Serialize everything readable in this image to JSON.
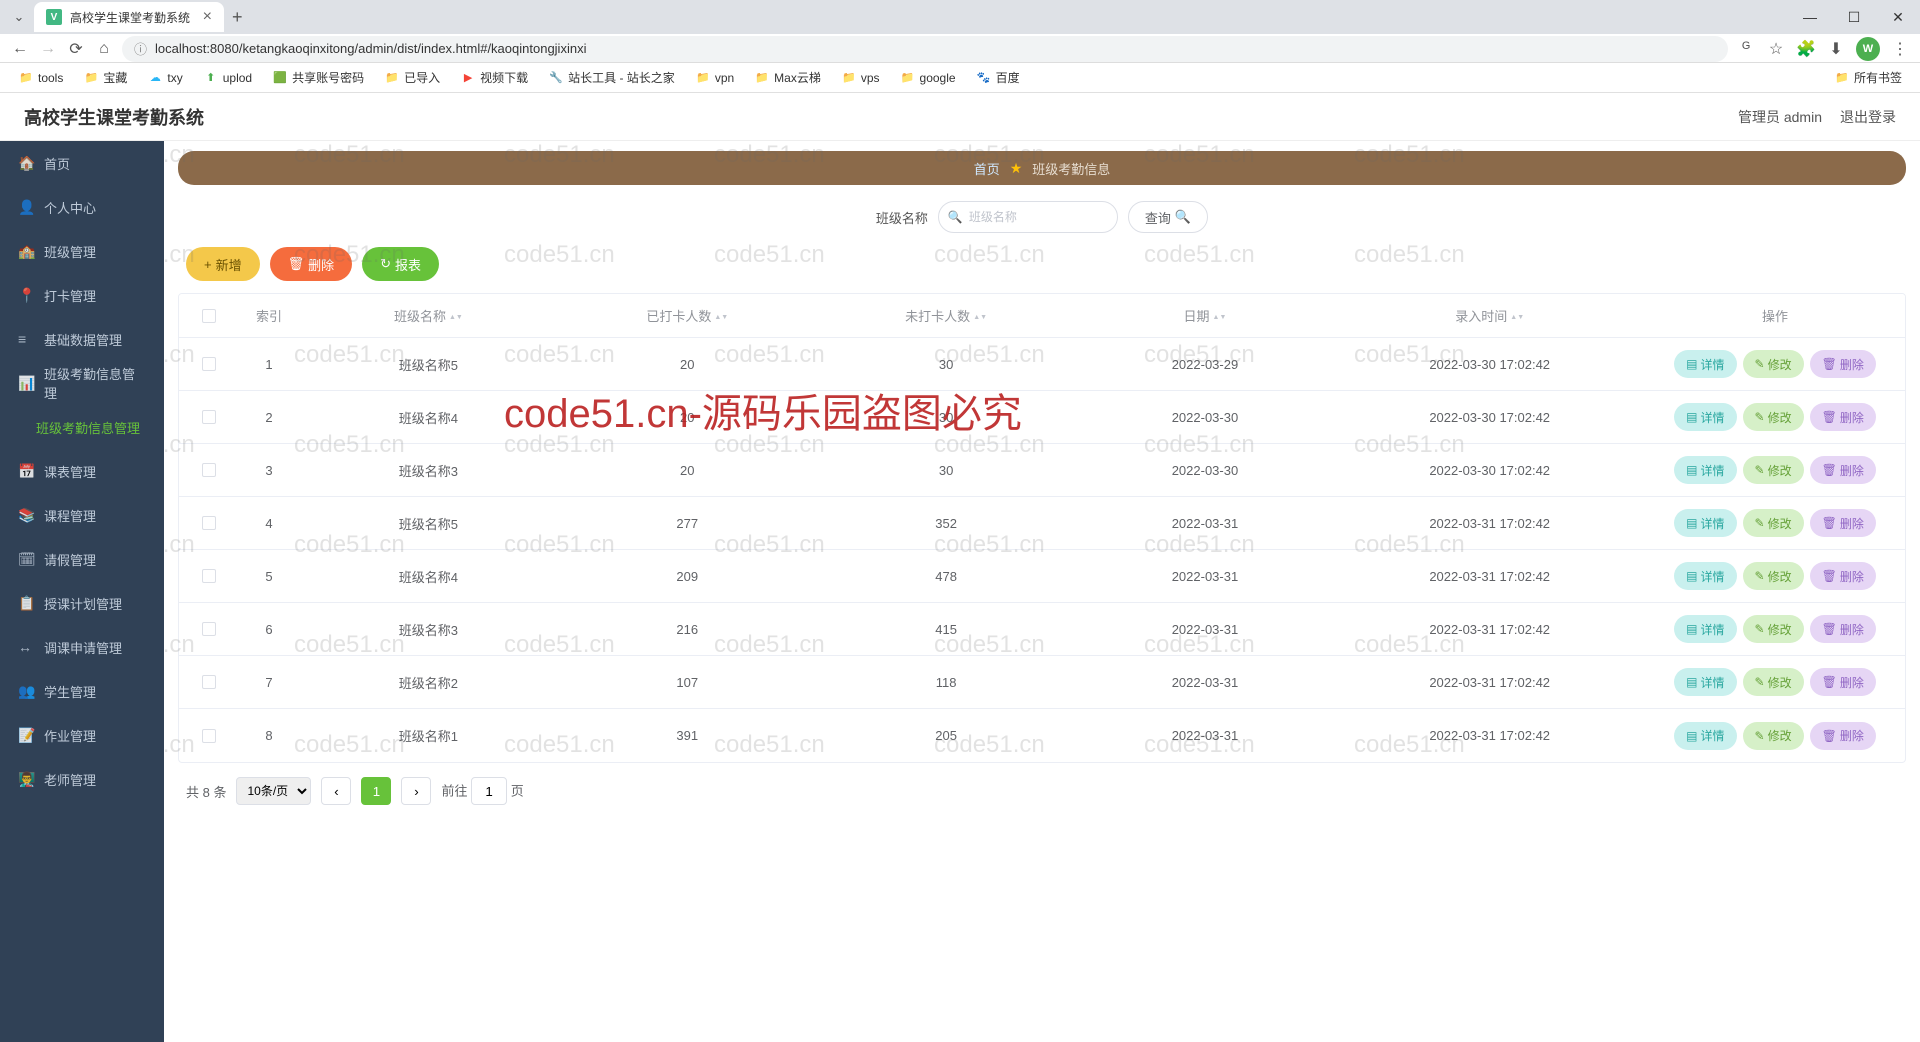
{
  "browser": {
    "tab_title": "高校学生课堂考勤系统",
    "tab_new": "+",
    "url": "localhost:8080/ketangkaoqinxitong/admin/dist/index.html#/kaoqintongjixinxi",
    "avatar": "W",
    "window": {
      "min": "—",
      "max": "☐",
      "close": "✕"
    },
    "bookmarks": [
      {
        "icon": "📁",
        "label": "tools"
      },
      {
        "icon": "📁",
        "label": "宝藏"
      },
      {
        "icon": "☁",
        "label": "txy",
        "color": "#29b6f6"
      },
      {
        "icon": "⬆",
        "label": "uplod",
        "color": "#4caf50"
      },
      {
        "icon": "🟩",
        "label": "共享账号密码"
      },
      {
        "icon": "📁",
        "label": "已导入"
      },
      {
        "icon": "▶",
        "label": "视频下载",
        "color": "#f44336"
      },
      {
        "icon": "🔧",
        "label": "站长工具 - 站长之家",
        "color": "#2196f3"
      },
      {
        "icon": "📁",
        "label": "vpn"
      },
      {
        "icon": "📁",
        "label": "Max云梯"
      },
      {
        "icon": "📁",
        "label": "vps"
      },
      {
        "icon": "📁",
        "label": "google"
      },
      {
        "icon": "🐾",
        "label": "百度",
        "color": "#2962ff"
      }
    ],
    "bookmarks_right": {
      "icon": "📁",
      "label": "所有书签"
    }
  },
  "header": {
    "title": "高校学生课堂考勤系统",
    "user": "管理员 admin",
    "logout": "退出登录"
  },
  "sidebar": {
    "items": [
      {
        "icon": "🏠",
        "label": "首页",
        "name": "home"
      },
      {
        "icon": "👤",
        "label": "个人中心",
        "name": "profile"
      },
      {
        "icon": "🏫",
        "label": "班级管理",
        "name": "class"
      },
      {
        "icon": "📍",
        "label": "打卡管理",
        "name": "checkin"
      },
      {
        "icon": "≡",
        "label": "基础数据管理",
        "name": "basedata"
      },
      {
        "icon": "📊",
        "label": "班级考勤信息管理",
        "name": "attendance-mgmt"
      },
      {
        "icon": "",
        "label": "班级考勤信息管理",
        "name": "attendance-info",
        "active": true,
        "sub": true
      },
      {
        "icon": "📅",
        "label": "课表管理",
        "name": "schedule"
      },
      {
        "icon": "📚",
        "label": "课程管理",
        "name": "course"
      },
      {
        "icon": "🗓",
        "label": "请假管理",
        "name": "leave"
      },
      {
        "icon": "📋",
        "label": "授课计划管理",
        "name": "plan"
      },
      {
        "icon": "↔",
        "label": "调课申请管理",
        "name": "reschedule"
      },
      {
        "icon": "👥",
        "label": "学生管理",
        "name": "student"
      },
      {
        "icon": "📝",
        "label": "作业管理",
        "name": "homework"
      },
      {
        "icon": "👨‍🏫",
        "label": "老师管理",
        "name": "teacher"
      }
    ]
  },
  "breadcrumb": {
    "home": "首页",
    "current": "班级考勤信息"
  },
  "search": {
    "label": "班级名称",
    "placeholder": "班级名称",
    "button": "查询"
  },
  "toolbar": {
    "add": "新增",
    "delete": "删除",
    "report": "报表"
  },
  "table": {
    "columns": [
      "索引",
      "班级名称",
      "已打卡人数",
      "未打卡人数",
      "日期",
      "录入时间",
      "操作"
    ],
    "action_labels": {
      "detail": "详情",
      "modify": "修改",
      "delete": "删除"
    },
    "rows": [
      {
        "idx": "1",
        "name": "班级名称5",
        "in": "20",
        "out": "30",
        "date": "2022-03-29",
        "time": "2022-03-30 17:02:42"
      },
      {
        "idx": "2",
        "name": "班级名称4",
        "in": "20",
        "out": "30",
        "date": "2022-03-30",
        "time": "2022-03-30 17:02:42"
      },
      {
        "idx": "3",
        "name": "班级名称3",
        "in": "20",
        "out": "30",
        "date": "2022-03-30",
        "time": "2022-03-30 17:02:42"
      },
      {
        "idx": "4",
        "name": "班级名称5",
        "in": "277",
        "out": "352",
        "date": "2022-03-31",
        "time": "2022-03-31 17:02:42"
      },
      {
        "idx": "5",
        "name": "班级名称4",
        "in": "209",
        "out": "478",
        "date": "2022-03-31",
        "time": "2022-03-31 17:02:42"
      },
      {
        "idx": "6",
        "name": "班级名称3",
        "in": "216",
        "out": "415",
        "date": "2022-03-31",
        "time": "2022-03-31 17:02:42"
      },
      {
        "idx": "7",
        "name": "班级名称2",
        "in": "107",
        "out": "118",
        "date": "2022-03-31",
        "time": "2022-03-31 17:02:42"
      },
      {
        "idx": "8",
        "name": "班级名称1",
        "in": "391",
        "out": "205",
        "date": "2022-03-31",
        "time": "2022-03-31 17:02:42"
      }
    ]
  },
  "pagination": {
    "total_text": "共 8 条",
    "per_page": "10条/页",
    "current": "1",
    "goto_prefix": "前往",
    "goto_value": "1",
    "goto_suffix": "页"
  },
  "watermark": {
    "text": "code51.cn",
    "big": "code51.cn-源码乐园盗图必究"
  }
}
